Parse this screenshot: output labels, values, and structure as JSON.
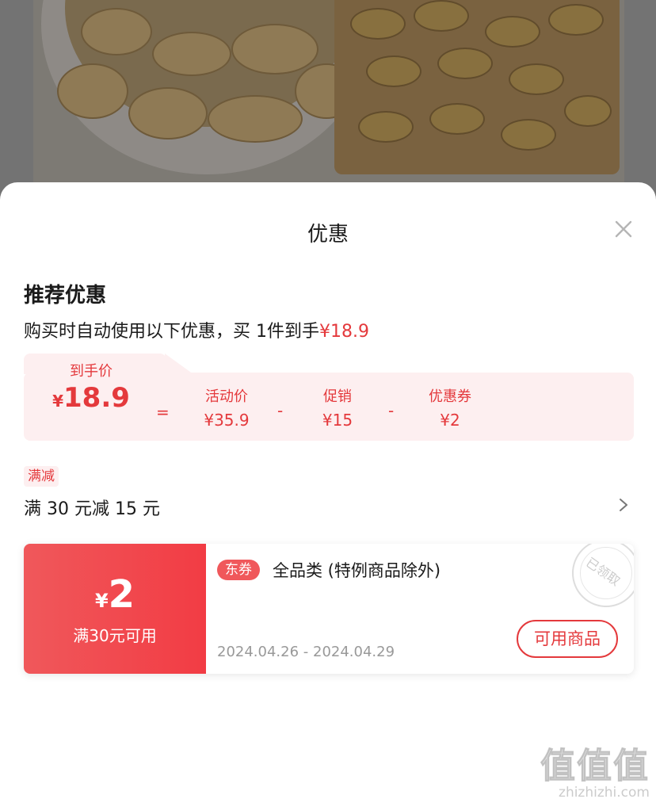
{
  "sheet": {
    "title": "优惠",
    "close_icon": "close-icon"
  },
  "recommend": {
    "title": "推荐优惠",
    "desc_prefix": "购买时自动使用以下优惠，买 1件到手",
    "desc_price": "¥18.9"
  },
  "formula": {
    "final_label": "到手价",
    "final_yen": "¥",
    "final_value": "18.9",
    "eq": "=",
    "activity_label": "活动价",
    "activity_value": "¥35.9",
    "minus1": "-",
    "promo_label": "促销",
    "promo_value": "¥15",
    "minus2": "-",
    "coupon_label": "优惠券",
    "coupon_value": "¥2"
  },
  "promotion": {
    "tag": "满减",
    "rule": "满 30 元减 15 元"
  },
  "coupon": {
    "yen": "¥",
    "amount": "2",
    "condition": "满30元可用",
    "tag": "东券",
    "description": "全品类 (特例商品除外)",
    "date_range": "2024.04.26 - 2024.04.29",
    "button_label": "可用商品",
    "stamp_text": "已领取"
  },
  "watermark": {
    "logo": "值值值",
    "url": "zhizhizhi.com"
  },
  "colors": {
    "accent": "#e4393c",
    "light_red_bg": "#fdeff0"
  }
}
